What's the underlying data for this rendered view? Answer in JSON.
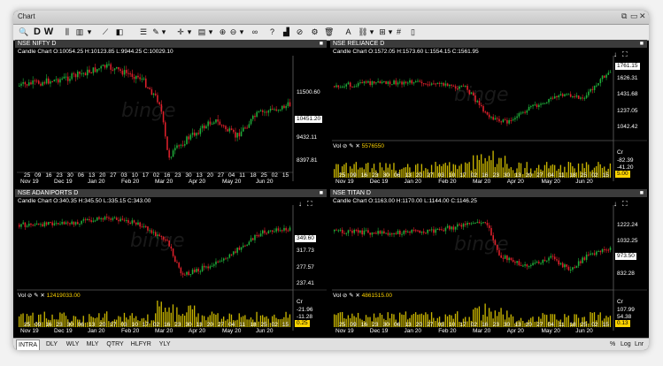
{
  "window": {
    "title": "Chart"
  },
  "toolbar": {
    "d_label": "D",
    "w_label": "W"
  },
  "panels": [
    {
      "name": "NSE NIFTY D",
      "ohlc": "Candle Chart  O:10054.25  H:10123.85  L:9944.25  C:10029.10",
      "watermark": "binge",
      "price_ticks": [
        "11500.60",
        "10451.20",
        "9432.11",
        "8397.81"
      ],
      "price_box": "10451.20",
      "date_row1": [
        "25",
        "09",
        "16",
        "23",
        "30",
        "06",
        "13",
        "20",
        "27",
        "03",
        "10",
        "17",
        "02",
        "16",
        "23",
        "30",
        "13",
        "20",
        "27",
        "04",
        "11",
        "18",
        "25",
        "02",
        "15"
      ],
      "date_row2": [
        "Nov 19",
        "Dec 19",
        "Jan 20",
        "Feb 20",
        "Mar 20",
        "Apr 20",
        "May 20",
        "Jun 20"
      ]
    },
    {
      "name": "NSE RELIANCE D",
      "ohlc": "Candle Chart  O:1572.05  H:1573.60  L:1554.15  C:1561.95",
      "watermark": "binge",
      "price_ticks": [
        "1761.15",
        "1626.31",
        "1431.68",
        "1237.05",
        "1042.42"
      ],
      "price_box": "1761.15",
      "vol_label": "Vol",
      "vol_value": "5576550",
      "vol_ticks": [
        "Cr",
        "-82.39",
        "-41.20"
      ],
      "vol_box": "5.00",
      "date_row1": [
        "25",
        "09",
        "16",
        "23",
        "30",
        "06",
        "13",
        "20",
        "27",
        "03",
        "10",
        "17",
        "02",
        "16",
        "23",
        "30",
        "13",
        "20",
        "27",
        "04",
        "11",
        "18",
        "25",
        "02",
        "15"
      ],
      "date_row2": [
        "Nov 19",
        "Dec 19",
        "Jan 20",
        "Feb 20",
        "Mar 20",
        "Apr 20",
        "May 20",
        "Jun 20"
      ]
    },
    {
      "name": "NSE ADANIPORTS D",
      "ohlc": "Candle Chart  O:340.35  H:345.50  L:335.15  C:343.00",
      "watermark": "binge",
      "price_ticks": [
        "349.60",
        "317.73",
        "277.57",
        "237.41"
      ],
      "price_box": "349.60",
      "vol_label": "Vol",
      "vol_value": "12419033.00",
      "vol_ticks": [
        "Cr",
        "-21.96",
        "-11.28"
      ],
      "vol_box": "0.25",
      "date_row1": [
        "25",
        "09",
        "16",
        "23",
        "30",
        "06",
        "13",
        "20",
        "27",
        "03",
        "10",
        "17",
        "02",
        "16",
        "23",
        "30",
        "13",
        "20",
        "27",
        "04",
        "11",
        "18",
        "25",
        "02",
        "15"
      ],
      "date_row2": [
        "Nov 19",
        "Dec 19",
        "Jan 20",
        "Feb 20",
        "Mar 20",
        "Apr 20",
        "May 20",
        "Jun 20"
      ]
    },
    {
      "name": "NSE TITAN D",
      "ohlc": "Candle Chart  O:1163.00  H:1170.00  L:1144.00  C:1146.25",
      "watermark": "binge",
      "price_ticks": [
        "1222.24",
        "1032.25",
        "973.50",
        "832.28"
      ],
      "price_box": "973.50",
      "vol_label": "Vol",
      "vol_value": "4861515.00",
      "vol_ticks": [
        "Cr",
        "107.99",
        "54.38"
      ],
      "vol_box": "0.13",
      "date_row1": [
        "25",
        "09",
        "16",
        "23",
        "30",
        "06",
        "13",
        "20",
        "27",
        "03",
        "10",
        "17",
        "02",
        "16",
        "23",
        "30",
        "13",
        "20",
        "27",
        "04",
        "11",
        "18",
        "25",
        "02",
        "15"
      ],
      "date_row2": [
        "Nov 19",
        "Dec 19",
        "Jan 20",
        "Feb 20",
        "Mar 20",
        "Apr 20",
        "May 20",
        "Jun 20"
      ]
    }
  ],
  "bottom_tabs": [
    "INTRA",
    "DLY",
    "WLY",
    "MLY",
    "QTRY",
    "HLFYR",
    "YLY"
  ],
  "bottom_selected": "INTRA",
  "bottom_right": [
    "%",
    "Log",
    "Lnr"
  ],
  "colors": {
    "up": "#1fae3a",
    "down": "#e0202b",
    "volume": "#c8b400",
    "background": "#000000"
  }
}
